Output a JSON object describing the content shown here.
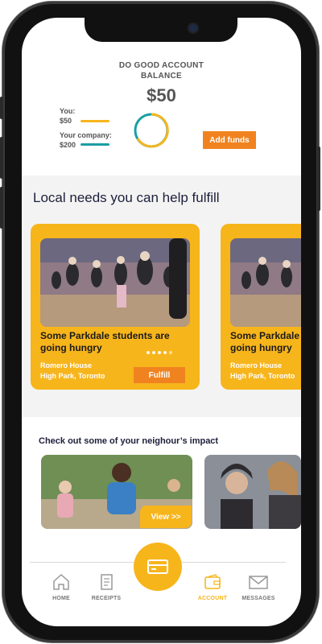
{
  "balance": {
    "title_line1": "DO GOOD ACCOUNT",
    "title_line2": "BALANCE",
    "amount": "$50",
    "you_label": "You:",
    "you_amount": "$50",
    "company_label": "Your company:",
    "company_amount": "$200",
    "add_funds_label": "Add funds"
  },
  "local_needs": {
    "title": "Local needs you can help fulfill",
    "cards": [
      {
        "title": "Some Parkdale students are going hungry",
        "org": "Romero House",
        "location": "High Park, Toronto",
        "action_label": "Fulfill",
        "dots_total": 5,
        "dots_active": 4
      },
      {
        "title": "Some Parkdale students are going hungry",
        "org": "Romero House",
        "location": "High Park, Toronto"
      }
    ]
  },
  "impact": {
    "title": "Check out some of your neighour’s impact",
    "view_label": "View >>"
  },
  "nav": {
    "items": [
      {
        "label": "HOME",
        "icon": "home-icon"
      },
      {
        "label": "RECEIPTS",
        "icon": "receipt-icon"
      },
      {
        "label": "ACCOUNT",
        "icon": "wallet-icon",
        "active": true
      },
      {
        "label": "MESSAGES",
        "icon": "envelope-icon"
      }
    ],
    "center_icon": "credit-card-icon"
  },
  "colors": {
    "accent_yellow": "#f7b51c",
    "accent_orange": "#f08320",
    "teal": "#1a9ea4",
    "heading": "#1d1f3a"
  }
}
